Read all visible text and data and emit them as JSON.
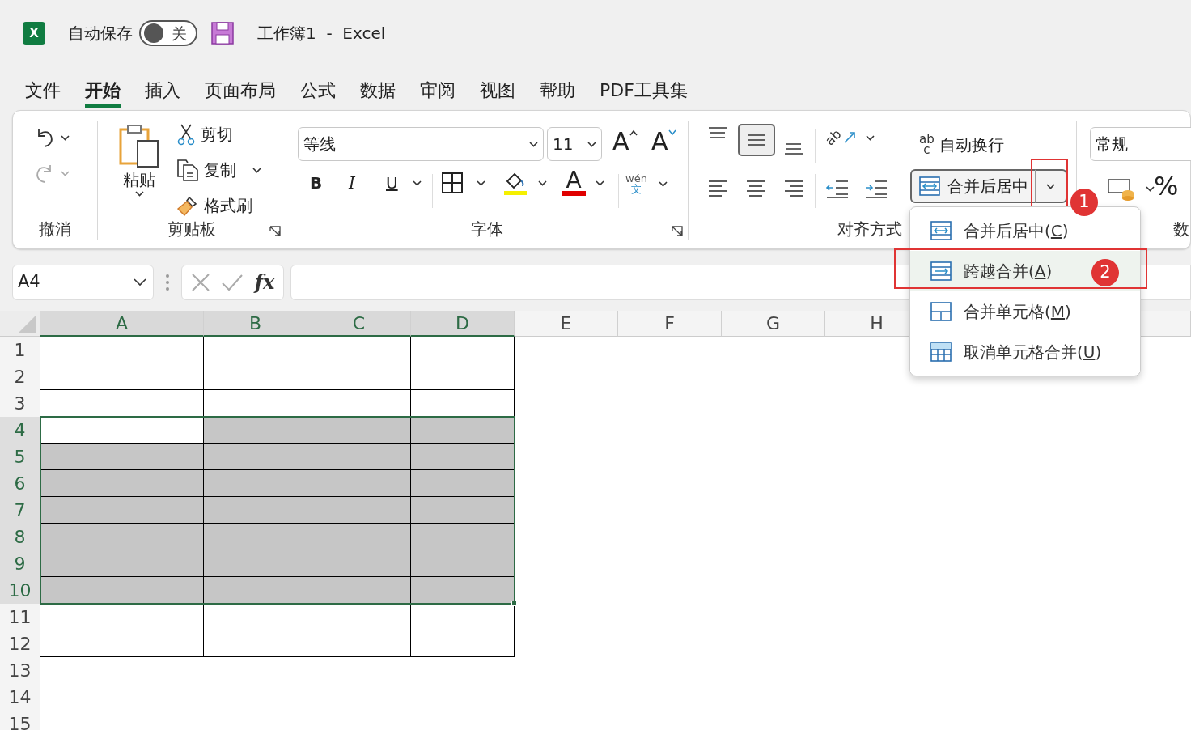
{
  "title_bar": {
    "app_icon_letter": "X",
    "autosave_label": "自动保存",
    "autosave": {
      "on": false,
      "label": "关"
    },
    "title": "工作簿1  -  Excel"
  },
  "tabs": [
    {
      "label": "文件",
      "selected": false
    },
    {
      "label": "开始",
      "selected": true
    },
    {
      "label": "插入",
      "selected": false
    },
    {
      "label": "页面布局",
      "selected": false
    },
    {
      "label": "公式",
      "selected": false
    },
    {
      "label": "数据",
      "selected": false
    },
    {
      "label": "审阅",
      "selected": false
    },
    {
      "label": "视图",
      "selected": false
    },
    {
      "label": "帮助",
      "selected": false
    },
    {
      "label": "PDF工具集",
      "selected": false
    }
  ],
  "ribbon": {
    "undo": {
      "label": "撤消",
      "undo_disabled": false,
      "redo_disabled": true
    },
    "clipboard": {
      "label": "剪贴板",
      "paste": "粘贴",
      "cut": "剪切",
      "copy": "复制",
      "format_painter": "格式刷"
    },
    "font": {
      "label": "字体",
      "font_name": "等线",
      "font_size": "11",
      "grow": "A",
      "shrink": "A",
      "bold": "B",
      "italic": "I",
      "underline": "U",
      "font_color": "A",
      "phonetic_top": "wén",
      "phonetic_bottom": "文"
    },
    "alignment": {
      "label": "对齐方式",
      "orientation_text": "ab",
      "wrap_icon_text": "ab",
      "wrap_icon_text2": "c",
      "wrap_text": "自动换行",
      "merge_button": "合并后居中",
      "merge_annotation": "1",
      "vertical": [
        {
          "kind": "top",
          "selected": false
        },
        {
          "kind": "middle",
          "selected": true
        },
        {
          "kind": "bottom",
          "selected": false
        }
      ],
      "horizontal": [
        {
          "kind": "left",
          "selected": false
        },
        {
          "kind": "center",
          "selected": false
        },
        {
          "kind": "right",
          "selected": false
        }
      ]
    },
    "number": {
      "format": "常规",
      "percent": "%",
      "label": "数"
    }
  },
  "merge_menu": [
    {
      "kind": "center",
      "label": "合并后居中(",
      "key": "C",
      "after": ")",
      "selected": false
    },
    {
      "kind": "across",
      "label": "跨越合并(",
      "key": "A",
      "after": ")",
      "selected": true,
      "annotation": "2"
    },
    {
      "kind": "merge",
      "label": "合并单元格(",
      "key": "M",
      "after": ")",
      "selected": false
    },
    {
      "kind": "unmerge",
      "label": "取消单元格合并(",
      "key": "U",
      "after": ")",
      "selected": false
    }
  ],
  "formula_bar": {
    "name_box": "A4",
    "fx": "fx"
  },
  "sheet": {
    "columns": [
      {
        "label": "A",
        "selected": true
      },
      {
        "label": "B",
        "selected": true
      },
      {
        "label": "C",
        "selected": true
      },
      {
        "label": "D",
        "selected": true
      },
      {
        "label": "E",
        "selected": false
      },
      {
        "label": "F",
        "selected": false
      },
      {
        "label": "G",
        "selected": false
      },
      {
        "label": "H",
        "selected": false
      }
    ],
    "rows": [
      {
        "label": "1",
        "selected": false,
        "cells": [
          {
            "bordered": true
          },
          {
            "bordered": true
          },
          {
            "bordered": true
          },
          {
            "bordered": true
          }
        ]
      },
      {
        "label": "2",
        "selected": false,
        "cells": [
          {
            "bordered": true
          },
          {
            "bordered": true
          },
          {
            "bordered": true
          },
          {
            "bordered": true
          }
        ]
      },
      {
        "label": "3",
        "selected": false,
        "cells": [
          {
            "bordered": true
          },
          {
            "bordered": true
          },
          {
            "bordered": true
          },
          {
            "bordered": true
          }
        ]
      },
      {
        "label": "4",
        "selected": true,
        "cells": [
          {
            "bordered": true
          },
          {
            "bordered": true
          },
          {
            "bordered": true
          },
          {
            "bordered": true
          }
        ]
      },
      {
        "label": "5",
        "selected": true,
        "cells": [
          {
            "bordered": true
          },
          {
            "bordered": true
          },
          {
            "bordered": true
          },
          {
            "bordered": true
          }
        ]
      },
      {
        "label": "6",
        "selected": true,
        "cells": [
          {
            "bordered": true
          },
          {
            "bordered": true
          },
          {
            "bordered": true
          },
          {
            "bordered": true
          }
        ]
      },
      {
        "label": "7",
        "selected": true,
        "cells": [
          {
            "bordered": true
          },
          {
            "bordered": true
          },
          {
            "bordered": true
          },
          {
            "bordered": true
          }
        ]
      },
      {
        "label": "8",
        "selected": true,
        "cells": [
          {
            "bordered": true
          },
          {
            "bordered": true
          },
          {
            "bordered": true
          },
          {
            "bordered": true
          }
        ]
      },
      {
        "label": "9",
        "selected": true,
        "cells": [
          {
            "bordered": true
          },
          {
            "bordered": true
          },
          {
            "bordered": true
          },
          {
            "bordered": true
          }
        ]
      },
      {
        "label": "10",
        "selected": true,
        "cells": [
          {
            "bordered": true
          },
          {
            "bordered": true
          },
          {
            "bordered": true
          },
          {
            "bordered": true
          }
        ]
      },
      {
        "label": "11",
        "selected": false,
        "cells": [
          {
            "bordered": true
          },
          {
            "bordered": true
          },
          {
            "bordered": true
          },
          {
            "bordered": true
          }
        ]
      },
      {
        "label": "12",
        "selected": false,
        "cells": [
          {
            "bordered": true
          },
          {
            "bordered": true
          },
          {
            "bordered": true
          },
          {
            "bordered": true
          }
        ]
      },
      {
        "label": "13",
        "selected": false
      },
      {
        "label": "14",
        "selected": false
      },
      {
        "label": "15",
        "selected": false
      }
    ]
  }
}
